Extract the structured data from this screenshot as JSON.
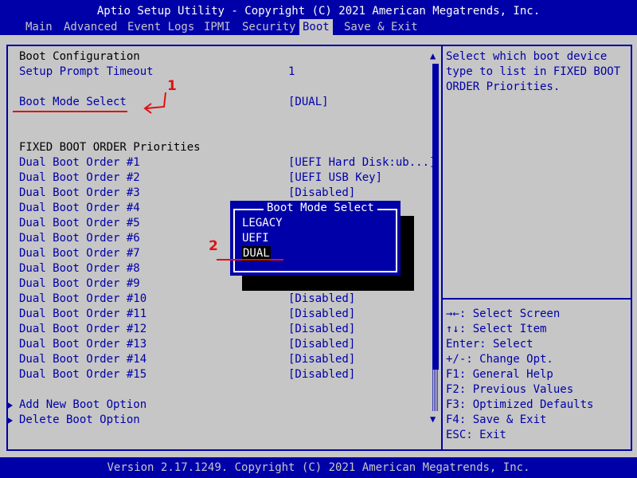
{
  "title": "Aptio Setup Utility - Copyright (C) 2021 American Megatrends, Inc.",
  "tabs": [
    {
      "label": "Main",
      "active": false
    },
    {
      "label": "Advanced",
      "active": false
    },
    {
      "label": "Event Logs",
      "active": false
    },
    {
      "label": "IPMI",
      "active": false
    },
    {
      "label": "Security",
      "active": false
    },
    {
      "label": "Boot",
      "active": true
    },
    {
      "label": "Save & Exit",
      "active": false
    }
  ],
  "boot_configuration": {
    "heading": "Boot Configuration",
    "setup_prompt_timeout": {
      "label": "Setup Prompt Timeout",
      "value": "1"
    },
    "boot_mode_select": {
      "label": "Boot Mode Select",
      "value": "[DUAL]"
    }
  },
  "fixed_boot_order": {
    "heading": "FIXED BOOT ORDER Priorities",
    "items": [
      {
        "label": "Dual Boot Order #1",
        "value": "[UEFI Hard Disk:ub...]"
      },
      {
        "label": "Dual Boot Order #2",
        "value": "[UEFI USB Key]"
      },
      {
        "label": "Dual Boot Order #3",
        "value": "[Disabled]"
      },
      {
        "label": "Dual Boot Order #4",
        "value": ""
      },
      {
        "label": "Dual Boot Order #5",
        "value": ""
      },
      {
        "label": "Dual Boot Order #6",
        "value": ""
      },
      {
        "label": "Dual Boot Order #7",
        "value": ""
      },
      {
        "label": "Dual Boot Order #8",
        "value": ""
      },
      {
        "label": "Dual Boot Order #9",
        "value": ""
      },
      {
        "label": "Dual Boot Order #10",
        "value": "[Disabled]"
      },
      {
        "label": "Dual Boot Order #11",
        "value": "[Disabled]"
      },
      {
        "label": "Dual Boot Order #12",
        "value": "[Disabled]"
      },
      {
        "label": "Dual Boot Order #13",
        "value": "[Disabled]"
      },
      {
        "label": "Dual Boot Order #14",
        "value": "[Disabled]"
      },
      {
        "label": "Dual Boot Order #15",
        "value": "[Disabled]"
      }
    ]
  },
  "submenus": [
    {
      "label": "Add New Boot Option"
    },
    {
      "label": "Delete Boot Option"
    }
  ],
  "help_text": "Select which boot device\ntype to list in FIXED BOOT\nORDER Priorities.",
  "key_help": [
    "→←: Select Screen",
    "↑↓: Select Item",
    "Enter: Select",
    "+/-: Change Opt.",
    "F1: General Help",
    "F2: Previous Values",
    "F3: Optimized Defaults",
    "F4: Save & Exit",
    "ESC: Exit"
  ],
  "popup": {
    "title": "Boot Mode Select",
    "options": [
      {
        "label": "LEGACY",
        "selected": false
      },
      {
        "label": "UEFI",
        "selected": false
      },
      {
        "label": "DUAL",
        "selected": true
      }
    ]
  },
  "annotations": [
    {
      "number": "1"
    },
    {
      "number": "2"
    }
  ],
  "footer": "Version 2.17.1249. Copyright (C) 2021 American Megatrends, Inc.",
  "colors": {
    "background": "#c6c6c6",
    "bios_blue": "#0000a8",
    "annotation_red": "#e01010"
  }
}
